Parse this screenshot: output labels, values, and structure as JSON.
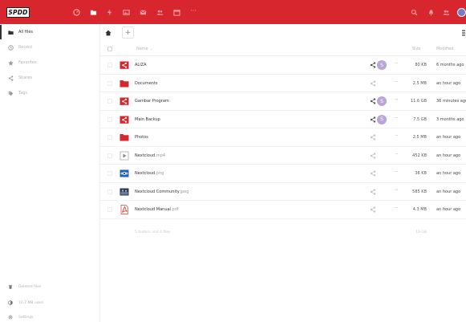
{
  "header": {
    "logo_text": "SPDD",
    "apps": [
      "dashboard-icon",
      "files-icon",
      "activity-icon",
      "gallery-icon",
      "mail-icon",
      "contacts-icon",
      "calendar-icon",
      "more-apps-icon"
    ],
    "right": [
      "search-icon",
      "notifications-icon",
      "contacts-menu-icon"
    ],
    "user_initial": "",
    "colors": {
      "brand": "#d7262e"
    }
  },
  "sidebar": {
    "items": [
      {
        "label": "All files",
        "icon": "folder-icon",
        "active": true
      },
      {
        "label": "Recent",
        "icon": "clock-icon"
      },
      {
        "label": "Favorites",
        "icon": "star-icon"
      },
      {
        "label": "Shares",
        "icon": "share-icon"
      },
      {
        "label": "Tags",
        "icon": "tag-icon"
      }
    ],
    "bottom": {
      "deleted": "Deleted files",
      "quota": "10.7 MB used",
      "settings": "Settings"
    }
  },
  "toolbar": {
    "new_label": "+"
  },
  "table": {
    "headers": {
      "name": "Name",
      "size": "Size",
      "modified": "Modified"
    },
    "rows": [
      {
        "name": "ALIZA",
        "ext": "",
        "type": "shared-folder",
        "shared_avatar": "S",
        "size": "80 KB",
        "modified": "6 months ago"
      },
      {
        "name": "Documents",
        "ext": "",
        "type": "folder",
        "shared_avatar": "",
        "size": "2.5 MB",
        "modified": "an hour ago"
      },
      {
        "name": "Gambar Program",
        "ext": "",
        "type": "shared-folder",
        "shared_avatar": "S",
        "size": "11.6 GB",
        "modified": "36 minutes ago"
      },
      {
        "name": "Main Backup",
        "ext": "",
        "type": "shared-folder",
        "shared_avatar": "S",
        "size": "7.5 GB",
        "modified": "3 months ago"
      },
      {
        "name": "Photos",
        "ext": "",
        "type": "folder",
        "shared_avatar": "",
        "size": "2.5 MB",
        "modified": "an hour ago"
      },
      {
        "name": "Nextcloud",
        "ext": ".mp4",
        "type": "video",
        "shared_avatar": "",
        "size": "452 KB",
        "modified": "an hour ago"
      },
      {
        "name": "Nextcloud",
        "ext": ".png",
        "type": "image-logo",
        "shared_avatar": "",
        "size": "36 KB",
        "modified": "an hour ago"
      },
      {
        "name": "Nextcloud Community",
        "ext": ".jpeg",
        "type": "image-photo",
        "shared_avatar": "",
        "size": "585 KB",
        "modified": "an hour ago"
      },
      {
        "name": "Nextcloud Manual",
        "ext": ".pdf",
        "type": "pdf",
        "shared_avatar": "",
        "size": "4.3 MB",
        "modified": "an hour ago"
      }
    ],
    "summary": {
      "text": "5 folders and 4 files",
      "total": "19 GB"
    }
  }
}
